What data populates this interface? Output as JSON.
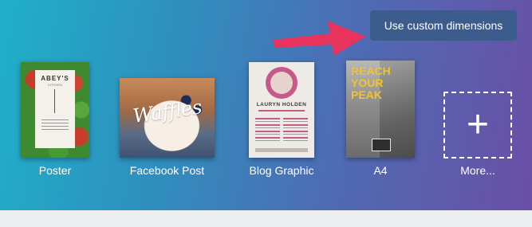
{
  "custom_dimensions": {
    "label": "Use custom dimensions"
  },
  "arrow": {
    "color": "#e8335c"
  },
  "templates": [
    {
      "label": "Poster",
      "thumb": {
        "title": "ABEY'S",
        "subtitle": "KITCHEN"
      }
    },
    {
      "label": "Facebook Post",
      "thumb": {
        "title": "Waffles"
      }
    },
    {
      "label": "Blog Graphic",
      "thumb": {
        "title": "LAURYN HOLDEN"
      }
    },
    {
      "label": "A4",
      "thumb": {
        "title": "REACH YOUR PEAK"
      }
    }
  ],
  "more": {
    "label": "More...",
    "icon": "+"
  },
  "colors": {
    "gradient_start": "#1fb0c9",
    "gradient_end": "#6a4fa6",
    "button_bg": "#3b5c8c",
    "page_bg": "#eceef0"
  }
}
